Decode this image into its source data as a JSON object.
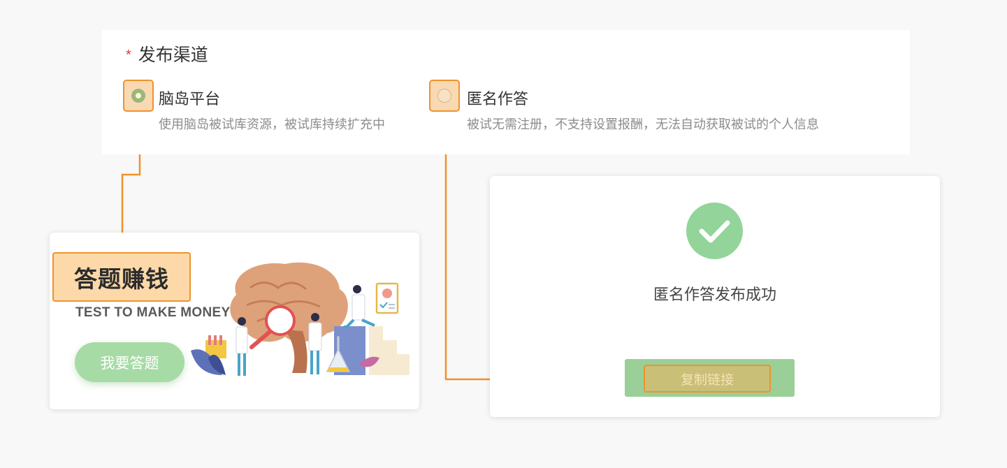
{
  "form": {
    "required_mark": "*",
    "section_title": "发布渠道",
    "options": [
      {
        "label": "脑岛平台",
        "desc": "使用脑岛被试库资源，被试库持续扩充中",
        "checked": true
      },
      {
        "label": "匿名作答",
        "desc": "被试无需注册，不支持设置报酬，无法自动获取被试的个人信息",
        "checked": false
      }
    ]
  },
  "promo": {
    "title": "答题赚钱",
    "subtitle": "TEST TO MAKE MONEY",
    "button_label": "我要答题"
  },
  "success": {
    "message": "匿名作答发布成功",
    "copy_button_label": "复制链接"
  },
  "colors": {
    "highlight_border": "#f0922a",
    "highlight_fill": "#fdd9a9",
    "success_green": "#92d499",
    "required": "#e23c3c"
  },
  "icons": [
    "check-icon",
    "brain-illustration"
  ]
}
